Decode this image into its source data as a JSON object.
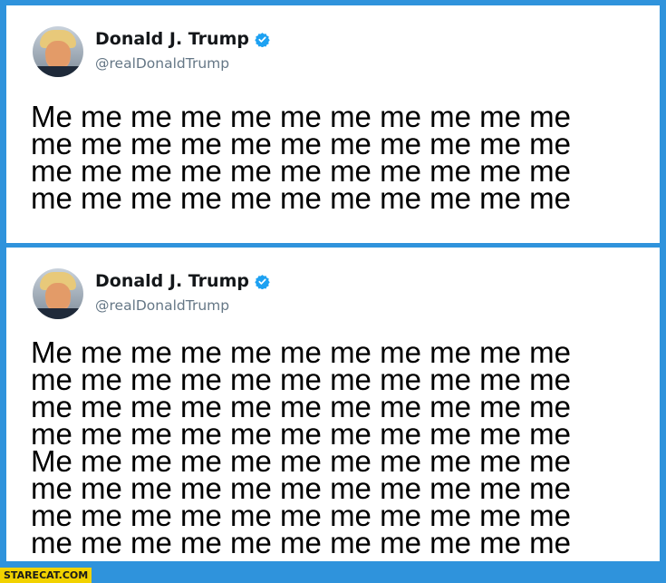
{
  "tweets": [
    {
      "author": {
        "name": "Donald J. Trump",
        "handle": "@realDonaldTrump",
        "verified": true
      },
      "lines": [
        "Me me me me me me me me me me me",
        "me me me me me me me me me me me",
        "me me me me me me me me me me me",
        "me me me me me me me me me me me"
      ]
    },
    {
      "author": {
        "name": "Donald J. Trump",
        "handle": "@realDonaldTrump",
        "verified": true
      },
      "lines": [
        "Me me me me me me me me me me me",
        "me me me me me me me me me me me",
        "me me me me me me me me me me me",
        "me me me me me me me me me me me",
        "Me me me me me me me me me me me",
        "me me me me me me me me me me me",
        "me me me me me me me me me me me",
        "me me me me me me me me me me me"
      ]
    }
  ],
  "watermark": "STARECAT.COM",
  "colors": {
    "background": "#2f93dc",
    "verified": "#1da1f2",
    "handle": "#657786"
  }
}
